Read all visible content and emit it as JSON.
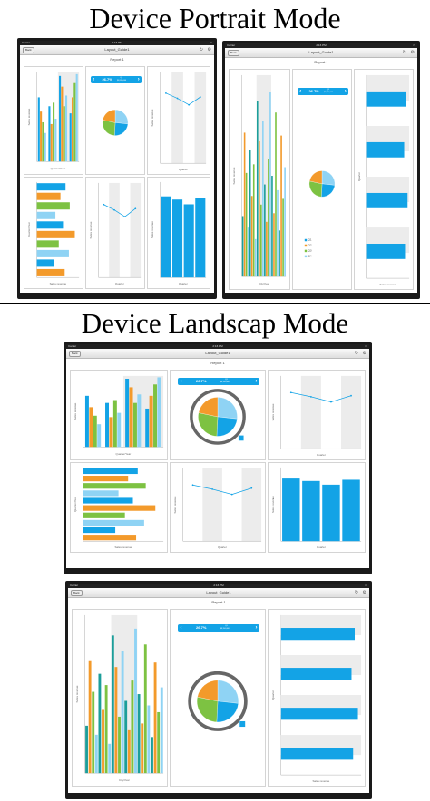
{
  "headings": {
    "portrait": "Device Portrait Mode",
    "landscape": "Device Landscap Mode"
  },
  "app": {
    "status_carrier": "Carrier",
    "status_time": "2:16 PM",
    "back_label": "Back",
    "nav_title": "Layout_Guide1",
    "report_title": "Report 1",
    "page_dots": "● ○",
    "refresh_icon": "refresh-icon",
    "settings_icon": "gear-icon"
  },
  "kpi": {
    "value": "26.7%",
    "sub_top": "Q1",
    "sub_bottom": "$8,150,000"
  },
  "axes": {
    "sales_revenue": "Sales revenue",
    "quarter_year": "Quarter/Year",
    "quarter": "Quarter",
    "city_year": "City/Year"
  },
  "colors": {
    "blue": "#13a3e6",
    "light_blue": "#8fd3f4",
    "orange": "#f39a2b",
    "green": "#7dc242",
    "teal": "#1c9e9a"
  },
  "legend": [
    "Q1",
    "Q2",
    "Q3",
    "Q4"
  ],
  "chart_data": [
    {
      "type": "bar",
      "name": "quarter-year-columns",
      "series": [
        {
          "values": [
            3.6,
            3.1,
            4.8,
            2.7
          ]
        },
        {
          "values": [
            2.8,
            2.1,
            4.2,
            3.6
          ]
        },
        {
          "values": [
            2.2,
            3.3,
            3.1,
            4.4
          ]
        },
        {
          "values": [
            1.6,
            2.4,
            3.7,
            4.9
          ]
        }
      ],
      "ylim": [
        0,
        5
      ]
    },
    {
      "type": "pie",
      "name": "quarter-share",
      "values": [
        26.7,
        24.1,
        27.5,
        21.7
      ],
      "labels": [
        "Q1",
        "Q2",
        "Q3",
        "Q4"
      ]
    },
    {
      "type": "line",
      "name": "revenue-by-quarter",
      "categories": [
        "Q1",
        "Q2",
        "Q3",
        "Q4"
      ],
      "values": [
        5.4,
        5.0,
        4.5,
        5.1
      ],
      "ylim": [
        0,
        7
      ]
    },
    {
      "type": "bar",
      "orientation": "horizontal",
      "name": "quarter-year-bars",
      "values": [
        3.4,
        2.8,
        3.9,
        2.2,
        3.1,
        4.5,
        2.6,
        3.8,
        2.0,
        3.3
      ],
      "xlim": [
        0,
        5
      ]
    },
    {
      "type": "bar",
      "name": "quarter-revenue-columns",
      "categories": [
        "Q1",
        "Q2",
        "Q3",
        "Q4"
      ],
      "values": [
        5.1,
        4.9,
        4.6,
        5.0
      ],
      "ylim": [
        0,
        6
      ]
    },
    {
      "type": "bar",
      "name": "city-year-columns",
      "values": [
        2.1,
        5.0,
        3.6,
        1.7,
        4.4,
        2.8,
        3.9,
        1.3,
        6.1,
        4.7,
        2.5,
        5.4,
        3.2,
        1.9,
        4.1,
        6.4,
        3.5,
        2.2,
        5.7,
        3.0,
        1.6,
        4.9,
        2.7,
        3.8
      ],
      "ylim": [
        0,
        7
      ]
    },
    {
      "type": "bar",
      "orientation": "horizontal",
      "name": "quarter-horizontal",
      "categories": [
        "Q1",
        "Q2",
        "Q3",
        "Q4"
      ],
      "values": [
        0.92,
        0.88,
        0.96,
        0.9
      ],
      "xlim": [
        0,
        1
      ]
    }
  ]
}
